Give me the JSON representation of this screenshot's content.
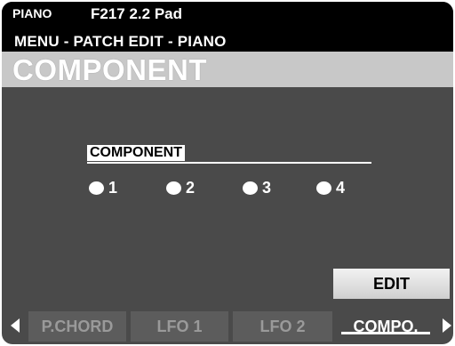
{
  "header": {
    "mode": "PIANO",
    "patch": "F217 2.2 Pad",
    "path": "MENU - PATCH EDIT - PIANO",
    "title": "COMPONENT"
  },
  "component": {
    "label": "COMPONENT",
    "options": [
      {
        "label": "1"
      },
      {
        "label": "2"
      },
      {
        "label": "3"
      },
      {
        "label": "4"
      }
    ]
  },
  "edit_button": {
    "label": "EDIT"
  },
  "tabs": [
    {
      "label": "P.CHORD",
      "active": false
    },
    {
      "label": "LFO 1",
      "active": false
    },
    {
      "label": "LFO 2",
      "active": false
    },
    {
      "label": "COMPO.",
      "active": true
    }
  ],
  "colors": {
    "screen_bg": "#4a4a4a",
    "title_bar": "#c8c8c8",
    "header_bg": "#000000"
  }
}
